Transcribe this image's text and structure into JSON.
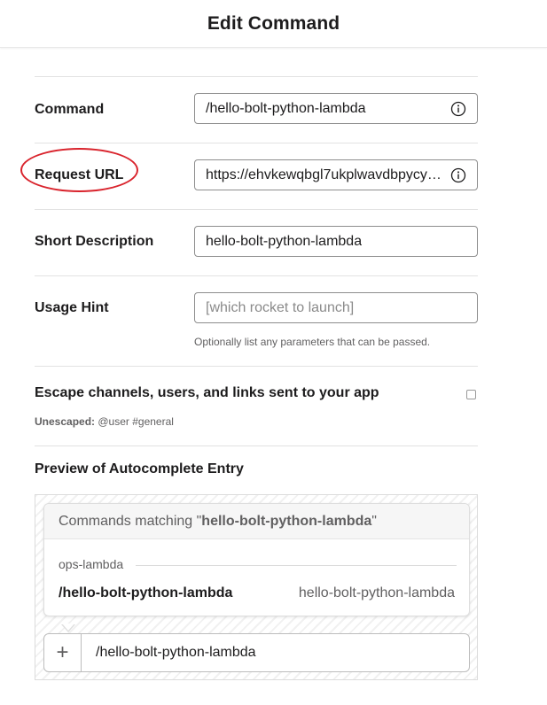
{
  "header": {
    "title": "Edit Command"
  },
  "fields": {
    "command": {
      "label": "Command",
      "value": "/hello-bolt-python-lambda"
    },
    "request_url": {
      "label": "Request URL",
      "value": "https://ehvkewqbgl7ukplwavdbpycy…"
    },
    "short_description": {
      "label": "Short Description",
      "value": "hello-bolt-python-lambda"
    },
    "usage_hint": {
      "label": "Usage Hint",
      "placeholder": "[which rocket to launch]",
      "help": "Optionally list any parameters that can be passed."
    }
  },
  "escape": {
    "label": "Escape channels, users, and links sent to your app",
    "checked": false,
    "unescaped_label": "Unescaped:",
    "unescaped_example": "@user #general"
  },
  "preview": {
    "title": "Preview of Autocomplete Entry",
    "matching_prefix": "Commands matching \"",
    "matching_term": "hello-bolt-python-lambda",
    "matching_suffix": "\"",
    "group": "ops-lambda",
    "command": "/hello-bolt-python-lambda",
    "description": "hello-bolt-python-lambda",
    "input_value": "/hello-bolt-python-lambda",
    "plus": "+"
  },
  "colors": {
    "highlight": "#d9232c"
  },
  "icons": {
    "info": "info-icon",
    "plus": "plus-icon"
  }
}
